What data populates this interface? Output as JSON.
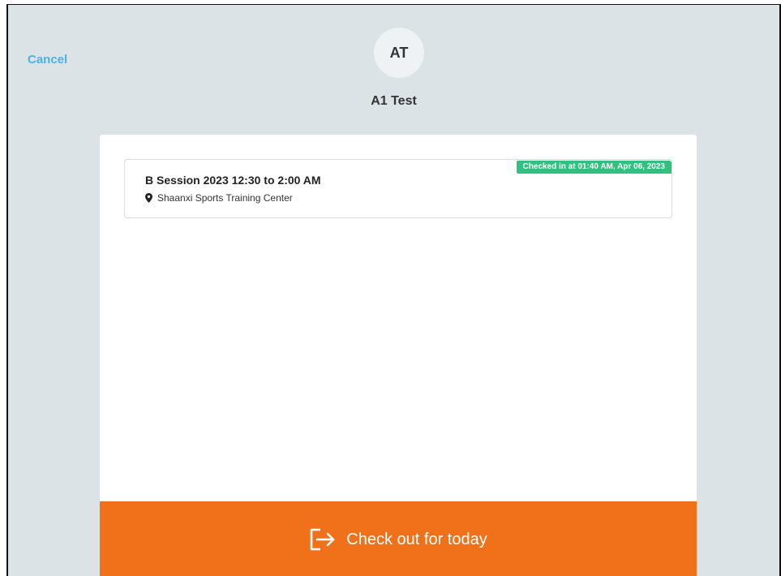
{
  "header": {
    "cancel_label": "Cancel",
    "avatar_initials": "AT",
    "user_name": "A1 Test"
  },
  "session": {
    "title": "B Session 2023 12:30 to 2:00 AM",
    "location": "Shaanxi Sports Training Center",
    "status_badge": "Checked in at 01:40 AM, Apr 06, 2023",
    "badge_color": "#2ec27e"
  },
  "footer": {
    "checkout_label": "Check out for today",
    "checkout_icon": "exit-icon",
    "accent_color": "#f07119"
  },
  "colors": {
    "background": "#dce3e7",
    "link": "#4ab3e6"
  }
}
